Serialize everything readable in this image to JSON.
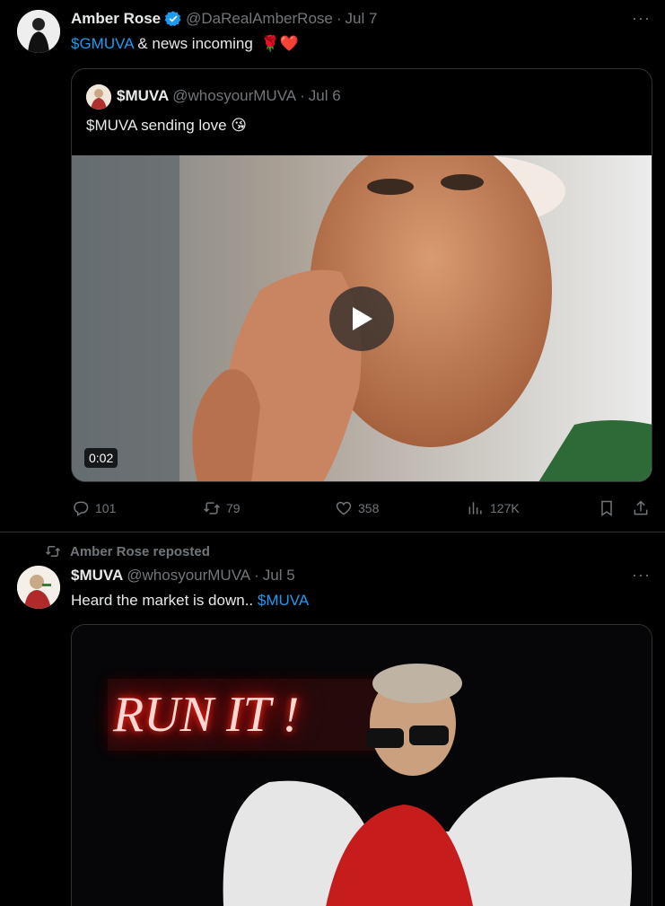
{
  "tweet1": {
    "name": "Amber Rose",
    "handle": "@DaRealAmberRose",
    "sep": "·",
    "date": "Jul 7",
    "text_cashtag": "$GMUVA",
    "text_rest": " & news incoming",
    "emoji": "🌹❤️",
    "more": "···",
    "quote": {
      "name": "$MUVA",
      "handle": "@whosyourMUVA",
      "sep": "·",
      "date": "Jul 6",
      "text": "$MUVA sending love 😘",
      "duration": "0:02"
    },
    "stats": {
      "replies": "101",
      "reposts": "79",
      "likes": "358",
      "views": "127K"
    }
  },
  "tweet2": {
    "reposted_by": "Amber Rose reposted",
    "name": "$MUVA",
    "handle": "@whosyourMUVA",
    "sep": "·",
    "date": "Jul 5",
    "text": "Heard the market is down.. ",
    "cashtag": "$MUVA",
    "more": "···",
    "media_text": "RUN IT !"
  },
  "colors": {
    "background": "#000000",
    "link": "#1d9bf0",
    "muted": "#71767b",
    "verified": "#1d9bf0",
    "border": "#2f3336"
  }
}
